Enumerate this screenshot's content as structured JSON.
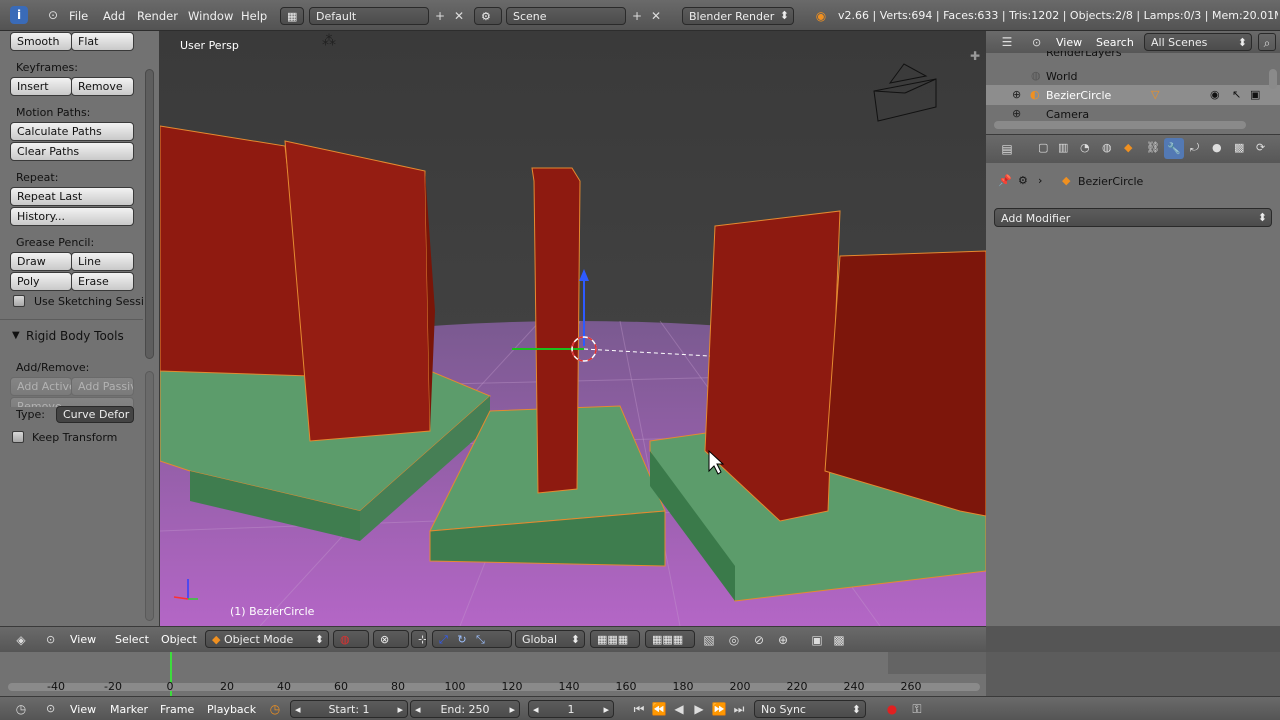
{
  "topbar": {
    "menus": [
      "File",
      "Add",
      "Render",
      "Window",
      "Help"
    ],
    "layout": "Default",
    "scene": "Scene",
    "engine": "Blender Render",
    "stats": "v2.66 | Verts:694 | Faces:633 | Tris:1202 | Objects:2/8 | Lamps:0/3 | Mem:20.01M (0.11"
  },
  "tools": {
    "smooth": "Smooth",
    "flat": "Flat",
    "keyframes_label": "Keyframes:",
    "insert": "Insert",
    "remove": "Remove",
    "motion_paths_label": "Motion Paths:",
    "calculate_paths": "Calculate Paths",
    "clear_paths": "Clear Paths",
    "repeat_label": "Repeat:",
    "repeat_last": "Repeat Last",
    "history": "History...",
    "grease_pencil_label": "Grease Pencil:",
    "draw": "Draw",
    "line": "Line",
    "poly": "Poly",
    "erase": "Erase",
    "use_sketching": "Use Sketching Sessi",
    "rigid_body_header": "Rigid Body Tools",
    "add_remove_label": "Add/Remove:",
    "add_active": "Add Active",
    "add_passive": "Add Passiv",
    "remove_partial": "Remove",
    "type_label": "Type:",
    "type_value": "Curve Defor",
    "keep_transform": "Keep Transform"
  },
  "viewport": {
    "persp_label": "User Persp",
    "object_label": "(1) BezierCircle"
  },
  "outliner": {
    "view": "View",
    "search": "Search",
    "scenes_select": "All Scenes",
    "items": [
      "RenderLayers",
      "World",
      "BezierCircle",
      "Camera"
    ]
  },
  "properties": {
    "object_name": "BezierCircle",
    "add_modifier": "Add Modifier"
  },
  "view3d_header": {
    "view": "View",
    "select": "Select",
    "object": "Object",
    "mode": "Object Mode",
    "orientation": "Global"
  },
  "timeline": {
    "ticks": [
      "-40",
      "-20",
      "0",
      "20",
      "40",
      "60",
      "80",
      "100",
      "120",
      "140",
      "160",
      "180",
      "200",
      "220",
      "240",
      "260"
    ],
    "current_frame": 1,
    "view": "View",
    "marker": "Marker",
    "frame": "Frame",
    "playback": "Playback",
    "start": "Start: 1",
    "end": "End: 250",
    "frame_value": "1",
    "sync": "No Sync"
  },
  "colors": {
    "panel_bg": "#727272",
    "header_bg": "#5a5a5a",
    "pillar_red": "#8b1a0f",
    "base_green": "#4e8c60",
    "floor_purple": "#a055b6",
    "selection_orange": "#e58a30"
  }
}
